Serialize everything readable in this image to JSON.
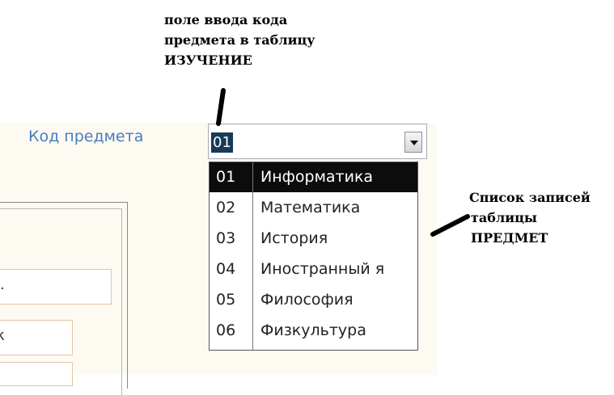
{
  "form": {
    "field_label": "Код предмета",
    "combo_value": "01",
    "partial_fields": [
      "l.",
      "к",
      ""
    ]
  },
  "dropdown": {
    "items": [
      {
        "code": "01",
        "name": "Информатика",
        "selected": true
      },
      {
        "code": "02",
        "name": "Математика",
        "selected": false
      },
      {
        "code": "03",
        "name": "История",
        "selected": false
      },
      {
        "code": "04",
        "name": "Иностранный я",
        "selected": false
      },
      {
        "code": "05",
        "name": "Философия",
        "selected": false
      },
      {
        "code": "06",
        "name": "Физкультура",
        "selected": false
      }
    ]
  },
  "annotations": {
    "input_note": [
      "поле ввода кода",
      "предмета в таблицу",
      "ИЗУЧЕНИЕ"
    ],
    "list_note": [
      "Список записей",
      "таблицы",
      "ПРЕДМЕТ"
    ]
  },
  "colors": {
    "label_blue": "#4a7cc0",
    "form_bg": "#fdfaf2",
    "selection_bg": "#0c0c0c",
    "combo_value_bg": "#173a56",
    "field_border": "#e0c7a6"
  }
}
